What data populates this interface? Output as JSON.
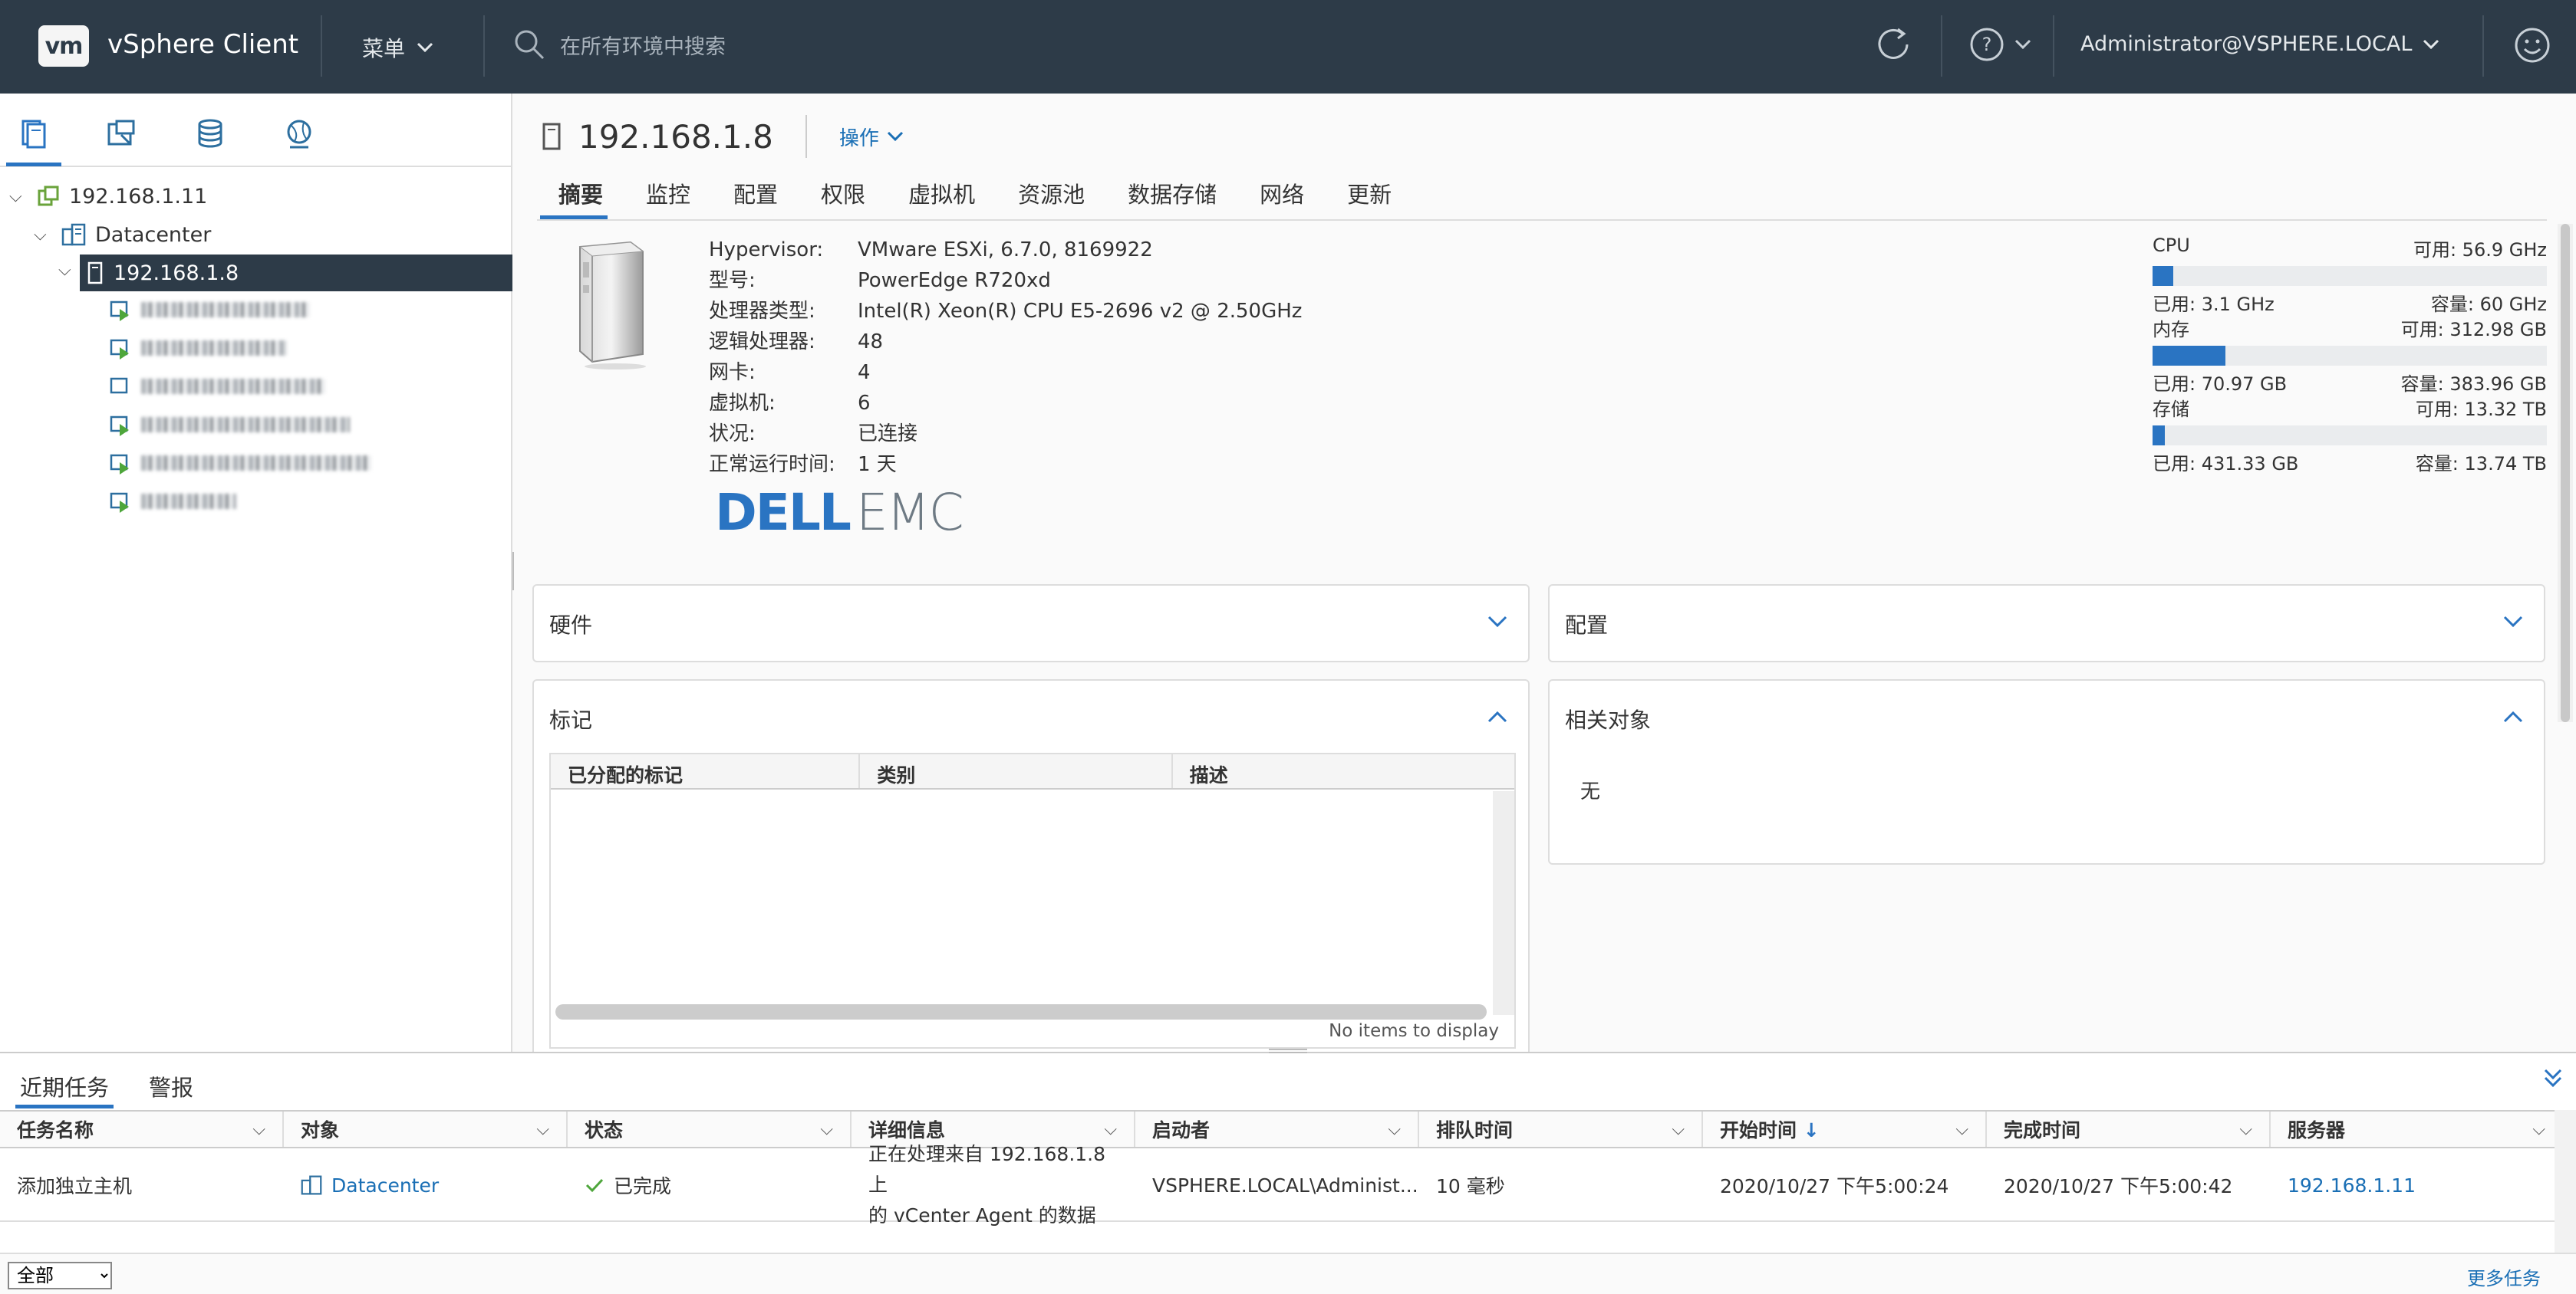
{
  "header": {
    "logo": "vm",
    "app_title": "vSphere Client",
    "menu_label": "菜单",
    "search_placeholder": "在所有环境中搜索",
    "user": "Administrator@VSPHERE.LOCAL"
  },
  "tree": {
    "root": "192.168.1.11",
    "datacenter": "Datacenter",
    "host": "192.168.1.8"
  },
  "object": {
    "name": "192.168.1.8",
    "actions_label": "操作"
  },
  "tabs": [
    "摘要",
    "监控",
    "配置",
    "权限",
    "虚拟机",
    "资源池",
    "数据存储",
    "网络",
    "更新"
  ],
  "summary": {
    "rows": [
      {
        "k": "Hypervisor:",
        "v": "VMware ESXi, 6.7.0, 8169922"
      },
      {
        "k": "型号:",
        "v": "PowerEdge R720xd"
      },
      {
        "k": "处理器类型:",
        "v": "Intel(R) Xeon(R) CPU E5-2696 v2 @ 2.50GHz"
      },
      {
        "k": "逻辑处理器:",
        "v": "48"
      },
      {
        "k": "网卡:",
        "v": "4"
      },
      {
        "k": "虚拟机:",
        "v": "6"
      },
      {
        "k": "状况:",
        "v": "已连接"
      },
      {
        "k": "正常运行时间:",
        "v": "1 天"
      }
    ],
    "brand_a": "DELL",
    "brand_b": "EMC"
  },
  "resources": {
    "cpu": {
      "label": "CPU",
      "free": "可用: 56.9 GHz",
      "used": "已用: 3.1 GHz",
      "cap": "容量: 60 GHz",
      "fraction": 0.052
    },
    "mem": {
      "label": "内存",
      "free": "可用: 312.98 GB",
      "used": "已用: 70.97 GB",
      "cap": "容量: 383.96 GB",
      "fraction": 0.185
    },
    "storage": {
      "label": "存储",
      "free": "可用: 13.32 TB",
      "used": "已用: 431.33 GB",
      "cap": "容量: 13.74 TB",
      "fraction": 0.031
    }
  },
  "cards": {
    "hardware": "硬件",
    "config": "配置",
    "tags": "标记",
    "related": "相关对象",
    "related_empty": "无",
    "tag_columns": [
      "已分配的标记",
      "类别",
      "描述"
    ],
    "tag_footer": "No items to display"
  },
  "tasks": {
    "tab_recent": "近期任务",
    "tab_alarms": "警报",
    "columns": [
      "任务名称",
      "对象",
      "状态",
      "详细信息",
      "启动者",
      "排队时间",
      "开始时间",
      "完成时间",
      "服务器"
    ],
    "sort_arrow": "↓",
    "row": {
      "name": "添加独立主机",
      "object": "Datacenter",
      "status": "已完成",
      "detail1": "正在处理来自 192.168.1.8 上",
      "detail2": "的 vCenter Agent 的数据",
      "initiator": "VSPHERE.LOCAL\\Administ...",
      "queued": "10 毫秒",
      "start": "2020/10/27 下午5:00:24",
      "end": "2020/10/27 下午5:00:42",
      "server": "192.168.1.11"
    },
    "filter_value": "全部",
    "more": "更多任务"
  }
}
